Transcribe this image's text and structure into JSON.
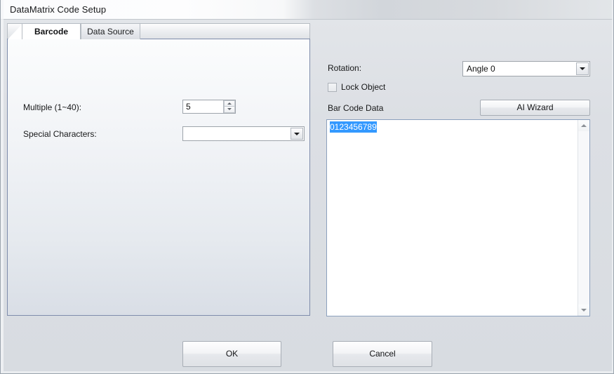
{
  "window": {
    "title": "DataMatrix Code Setup"
  },
  "tabs": [
    {
      "label": "Barcode",
      "active": true
    },
    {
      "label": "Data Source",
      "active": false
    }
  ],
  "barcode_panel": {
    "multiple": {
      "label": "Multiple (1~40):",
      "value": "5"
    },
    "special_characters": {
      "label": "Special Characters:",
      "value": "",
      "placeholder": ""
    }
  },
  "right_panel": {
    "rotation": {
      "label": "Rotation:",
      "value": "Angle 0"
    },
    "lock_object": {
      "label": "Lock Object",
      "checked": false
    },
    "bar_code_data": {
      "label": "Bar Code Data",
      "value": "0123456789"
    },
    "ai_wizard_button": "AI Wizard"
  },
  "footer": {
    "ok_label": "OK",
    "cancel_label": "Cancel"
  },
  "icons": {
    "spinner_up": "arrow-up-icon",
    "spinner_down": "arrow-down-icon",
    "combo_arrow": "chevron-down-icon",
    "scroll_up": "scroll-up-arrow-icon",
    "scroll_down": "scroll-down-arrow-icon"
  },
  "colors": {
    "selection": "#3399ff",
    "panel_border": "#7e8cab",
    "dialog_bg": "#dcdfe4"
  }
}
